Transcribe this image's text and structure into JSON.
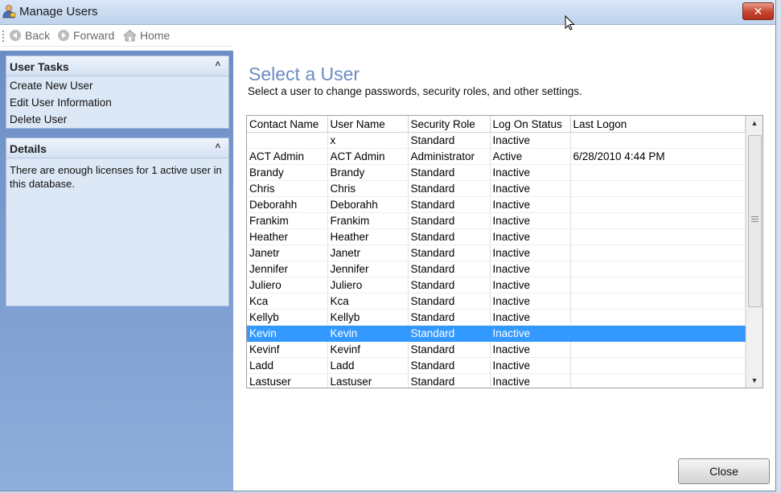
{
  "window": {
    "title": "Manage Users",
    "close_label": "✕"
  },
  "toolbar": {
    "back_label": "Back",
    "forward_label": "Forward",
    "home_label": "Home"
  },
  "sidebar": {
    "user_tasks": {
      "title": "User Tasks",
      "items": [
        "Create New User",
        "Edit User Information",
        "Delete User"
      ]
    },
    "details": {
      "title": "Details",
      "text": "There are enough licenses for 1 active user in this database."
    }
  },
  "main": {
    "heading": "Select a User",
    "subheading": "Select a user to change passwords, security roles, and other settings.",
    "table": {
      "columns": [
        "Contact Name",
        "User Name",
        "Security Role",
        "Log On Status",
        "Last Logon"
      ],
      "rows": [
        [
          "",
          "x",
          "Standard",
          "Inactive",
          ""
        ],
        [
          "ACT Admin",
          "ACT Admin",
          "Administrator",
          "Active",
          "6/28/2010 4:44 PM"
        ],
        [
          "Brandy",
          "Brandy",
          "Standard",
          "Inactive",
          ""
        ],
        [
          "Chris",
          "Chris",
          "Standard",
          "Inactive",
          ""
        ],
        [
          "Deborahh",
          "Deborahh",
          "Standard",
          "Inactive",
          ""
        ],
        [
          "Frankim",
          "Frankim",
          "Standard",
          "Inactive",
          ""
        ],
        [
          "Heather",
          "Heather",
          "Standard",
          "Inactive",
          ""
        ],
        [
          "Janetr",
          "Janetr",
          "Standard",
          "Inactive",
          ""
        ],
        [
          "Jennifer",
          "Jennifer",
          "Standard",
          "Inactive",
          ""
        ],
        [
          "Juliero",
          "Juliero",
          "Standard",
          "Inactive",
          ""
        ],
        [
          "Kca",
          "Kca",
          "Standard",
          "Inactive",
          ""
        ],
        [
          "Kellyb",
          "Kellyb",
          "Standard",
          "Inactive",
          ""
        ],
        [
          "Kevin",
          "Kevin",
          "Standard",
          "Inactive",
          ""
        ],
        [
          "Kevinf",
          "Kevinf",
          "Standard",
          "Inactive",
          ""
        ],
        [
          "Ladd",
          "Ladd",
          "Standard",
          "Inactive",
          ""
        ],
        [
          "Lastuser",
          "Lastuser",
          "Standard",
          "Inactive",
          ""
        ]
      ],
      "selected_row": 12
    },
    "close_button_label": "Close"
  },
  "colors": {
    "selection": "#3399ff",
    "heading": "#6a8cc4",
    "sidebar": "#7fa0d2"
  }
}
